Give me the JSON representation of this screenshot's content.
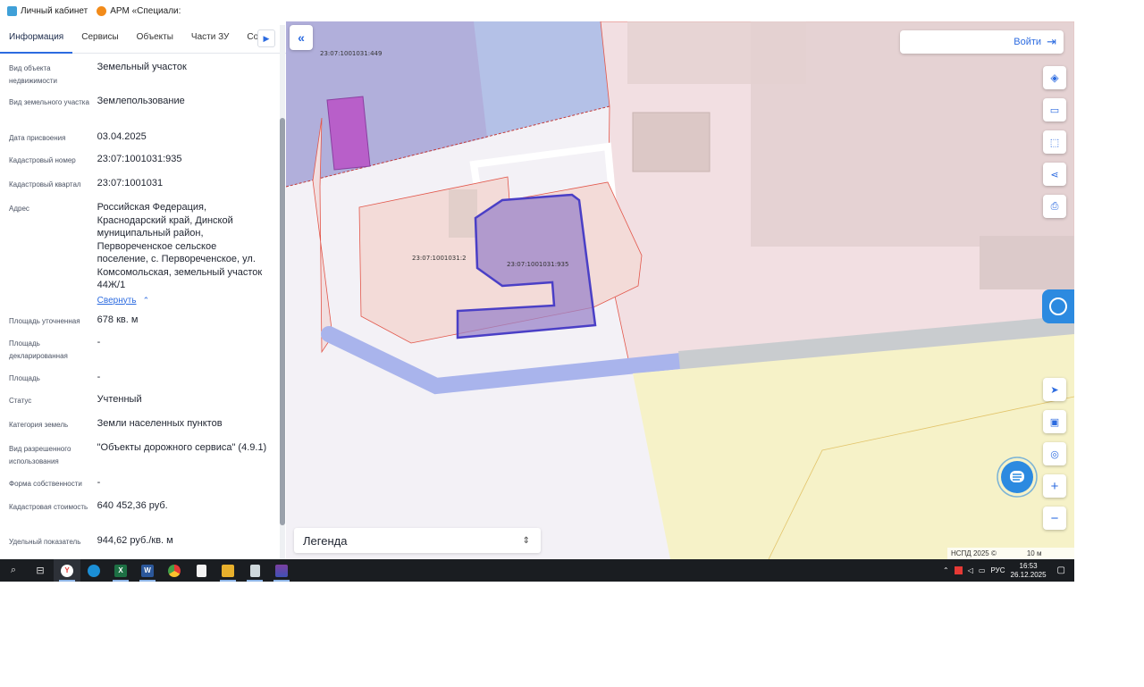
{
  "bookmarks": [
    {
      "label": "Личный кабинет",
      "color": "#3fa0d8"
    },
    {
      "label": "АРМ «Специали:",
      "color": "#f28b1a"
    }
  ],
  "tabs": [
    "Информация",
    "Сервисы",
    "Объекты",
    "Части ЗУ",
    "Соста"
  ],
  "tabs_next_icon": "chevron-right-icon",
  "info": {
    "type_label": "Вид объекта недвижимости",
    "type_value": "Земельный участок",
    "landtype_label": "Вид земельного участка",
    "landtype_value": "Землепользование",
    "date_label": "Дата присвоения",
    "date_value": "03.04.2025",
    "cadnum_label": "Кадастровый номер",
    "cadnum_value": "23:07:1001031:935",
    "quarter_label": "Кадастровый квартал",
    "quarter_value": "23:07:1001031",
    "address_label": "Адрес",
    "address_value": "Российская Федерация, Краснодарский край, Динской муниципальный район, Первореченское сельское поселение, с. Первореченское, ул. Комсомольская, земельный участок 44Ж/1",
    "collapse_link": "Свернуть",
    "area_refined_label": "Площадь уточненная",
    "area_refined_value": "678 кв. м",
    "area_declared_label": "Площадь декларированная",
    "area_declared_value": "-",
    "area_label": "Площадь",
    "area_value": "-",
    "status_label": "Статус",
    "status_value": "Учтенный",
    "category_label": "Категория земель",
    "category_value": "Земли населенных пунктов",
    "use_label": "Вид разрешенного использования",
    "use_value": "\"Объекты дорожного сервиса\" (4.9.1)",
    "ownership_label": "Форма собственности",
    "ownership_value": "-",
    "cost_label": "Кадастровая стоимость",
    "cost_value": "640 452,36 руб.",
    "specific_label": "Удельный показатель",
    "specific_value": "944,62 руб./кв. м"
  },
  "map": {
    "login_label": "Войти",
    "legend_title": "Легенда",
    "attribution": "НСПД 2025 ©",
    "scale_label": "10 м",
    "parcel_labels": [
      "23:07:1001031:449",
      "23:07:1001031:2",
      "23:07:1001031:935"
    ],
    "colors": {
      "selected_parcel": "#9b84c9",
      "selected_border": "#4a3fc6",
      "road": "#a9b4ec",
      "zone_yellow": "#f6f2c8",
      "zone_pink": "#f2dfe0",
      "accent": "#2c6be0"
    }
  },
  "map_controls": [
    "layers-icon",
    "ruler-icon",
    "select-area-icon",
    "share-icon",
    "print-icon",
    "locate-icon",
    "minimap-icon",
    "search-place-icon",
    "zoom-in-icon",
    "zoom-out-icon"
  ],
  "taskbar": {
    "apps": [
      "search-icon",
      "task-view-icon",
      "yandex-browser-icon",
      "edge-icon",
      "excel-icon",
      "word-icon",
      "chrome-icon",
      "file-icon",
      "file-explorer-icon",
      "archive-icon",
      "app-icon"
    ],
    "lang": "РУС",
    "time": "16:53",
    "date": "26.12.2025"
  }
}
